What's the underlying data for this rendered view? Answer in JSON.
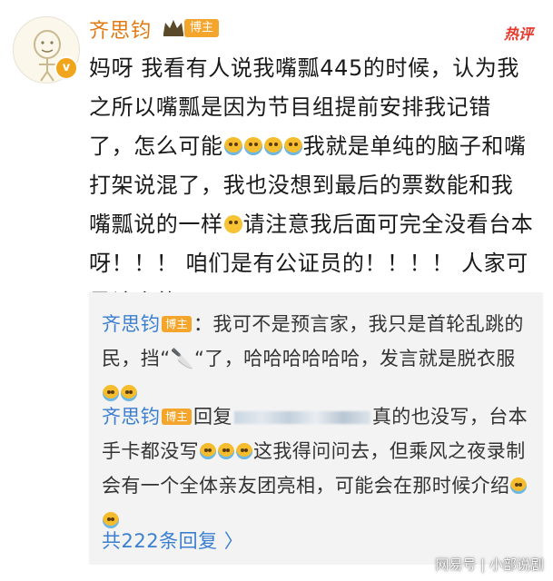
{
  "post": {
    "author": "齐思钧",
    "author_badge": "博主",
    "hot_tag": "热评",
    "text_parts": [
      "妈呀 我看有人说我嘴瓢445的时候，认为我之所以嘴瓢是因为节目组提前安排我记错了，怎么可能",
      "我就是单纯的脑子和嘴打架说混了，我也没想到最后的票数能和我嘴瓢说的一样",
      "请注意我后面可完全没看台本呀！！！ 咱们是有公证员的！！！！ 人家可是认真的！！"
    ]
  },
  "replies": [
    {
      "author": "齐思钧",
      "badge": "博主",
      "text": "：我可不是预言家，我只是首轮乱跳的民，挡“🔪“了，哈哈哈哈哈哈，发言就是脱衣服"
    },
    {
      "author": "齐思钧",
      "badge": "博主",
      "prefix": "回复",
      "text_a": "真的也没写，台本手卡都没写",
      "text_b": "这我得问问去，但乘风之夜录制会有一个全体亲友团亮相，可能会在那时候介绍"
    }
  ],
  "more_replies": "共222条回复 〉",
  "watermark": "网易号 | 小部说剧",
  "colors": {
    "author": "#e07a10",
    "reply_name": "#3b7fd1",
    "badge": "#f4a52b",
    "hot": "#e8382c"
  }
}
